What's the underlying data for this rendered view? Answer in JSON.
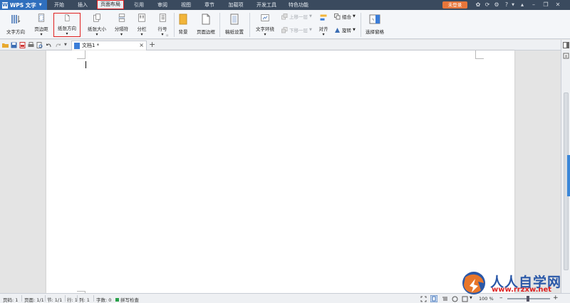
{
  "app": {
    "name": "WPS 文字",
    "login_label": "未登录"
  },
  "menu": {
    "tabs": [
      {
        "label": "开始"
      },
      {
        "label": "插入"
      },
      {
        "label": "页面布局",
        "active": true
      },
      {
        "label": "引用"
      },
      {
        "label": "审阅"
      },
      {
        "label": "视图"
      },
      {
        "label": "章节"
      },
      {
        "label": "加载项"
      },
      {
        "label": "开发工具"
      },
      {
        "label": "特色功能"
      }
    ]
  },
  "ribbon": {
    "text_direction": "文字方向",
    "margins": "页边距",
    "orientation": "纸张方向",
    "paper_size": "纸张大小",
    "breaks": "分隔符",
    "columns": "分栏",
    "line_numbers": "行号",
    "background": "背景",
    "page_border": "页面边框",
    "draft_paper": "稿纸设置",
    "text_wrap": "文字环绕",
    "bring_forward": "上移一层",
    "send_backward": "下移一层",
    "align": "对齐",
    "group": "组合",
    "rotate": "旋转",
    "selection_pane": "选择窗格"
  },
  "document": {
    "tab_title": "文档1 *"
  },
  "status": {
    "page": "页码: 1",
    "pages": "页面: 1/1",
    "section": "节: 1/1",
    "row": "行: 1",
    "column": "列: 1",
    "word_count": "字数: 0",
    "spell_check": "拼写检查",
    "zoom": "100 %"
  },
  "watermark": {
    "text": "人人自学网",
    "url": "www.rrzxw.net"
  },
  "colors": {
    "menubar": "#3a4a5e",
    "app_button": "#2f6fbd",
    "login_button": "#e8763a",
    "highlight": "#e02020"
  }
}
